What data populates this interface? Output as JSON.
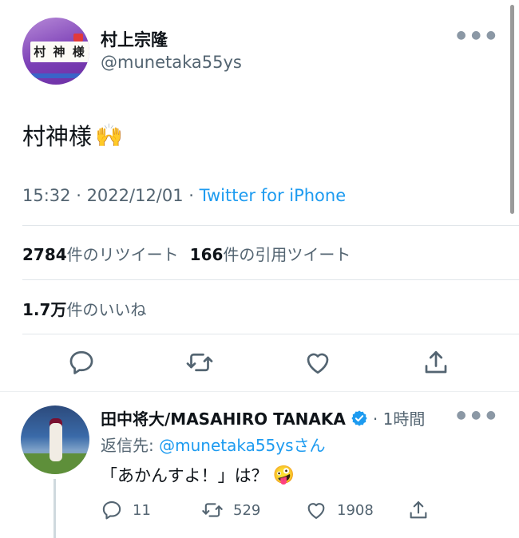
{
  "main_tweet": {
    "display_name": "村上宗隆",
    "handle": "@munetaka55ys",
    "avatar_board_text": "村 神 様",
    "text": "村神様",
    "emoji": "🙌",
    "time": "15:32",
    "date": "2022/12/01",
    "separator": " · ",
    "source": "Twitter for iPhone",
    "more_icon": "more-icon"
  },
  "stats": {
    "retweets_count": "2784",
    "retweets_label": "件のリツイート",
    "quotes_count": "166",
    "quotes_label": "件の引用ツイート",
    "likes_count": "1.7万",
    "likes_label": "件のいいね"
  },
  "actions": [
    "reply-icon",
    "retweet-icon",
    "like-icon",
    "share-icon"
  ],
  "reply": {
    "display_name": "田中将大/MASAHIRO TANAKA",
    "time": "1時間",
    "replying_to_prefix": "返信先: ",
    "replying_to_handle": "@munetaka55ys",
    "replying_to_suffix": "さん",
    "text": "「あかんすよ！」は？",
    "emoji": "🤪",
    "reply_count": "11",
    "retweet_count": "529",
    "like_count": "1908"
  },
  "colors": {
    "link": "#1d9bf0",
    "secondary_text": "#536471",
    "verified": "#1d9bf0"
  }
}
